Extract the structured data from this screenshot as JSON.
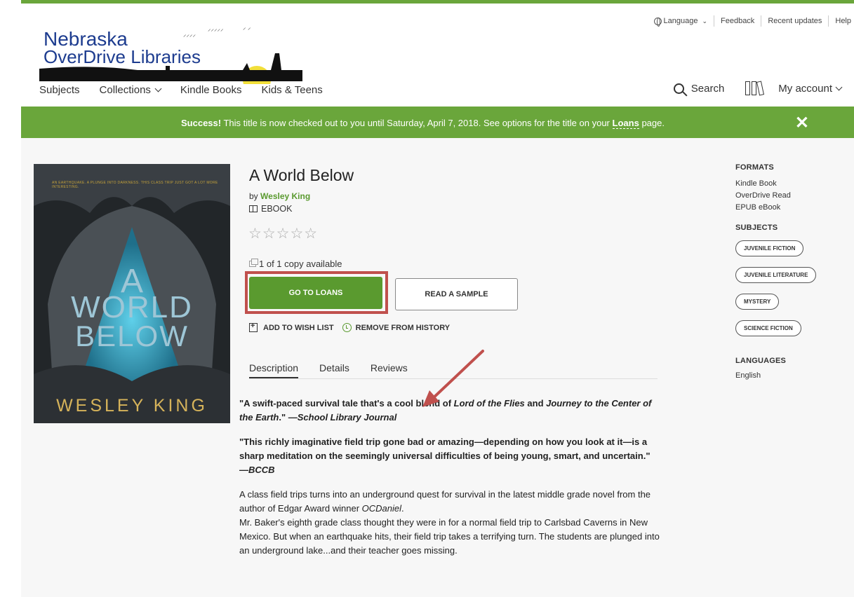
{
  "util_nav": {
    "language": "Language",
    "feedback": "Feedback",
    "recent_updates": "Recent updates",
    "help": "Help"
  },
  "logo": {
    "line1": "Nebraska",
    "line2": "OverDrive Libraries"
  },
  "main_nav": [
    {
      "label": "Subjects"
    },
    {
      "label": "Collections",
      "dropdown": true
    },
    {
      "label": "Kindle Books"
    },
    {
      "label": "Kids & Teens"
    }
  ],
  "right_nav": {
    "search": "Search",
    "account": "My account"
  },
  "banner": {
    "bold": "Success!",
    "text": "This title is now checked out to you until Saturday, April 7, 2018. See options for the title on your",
    "link": "Loans",
    "suffix": "page.",
    "close": "✕"
  },
  "book": {
    "cover_tag": "AN EARTHQUAKE. A PLUNGE INTO DARKNESS. THIS CLASS TRIP JUST GOT A LOT MORE INTERESTING.",
    "cover_line1": "A",
    "cover_line2": "WORLD",
    "cover_line3": "BELOW",
    "cover_author": "WESLEY KING",
    "title": "A World Below",
    "by": "by",
    "author": "Wesley King",
    "format": "EBOOK",
    "stars": "☆☆☆☆☆",
    "copies": "1 of 1 copy available",
    "go_to_loans": "GO TO LOANS",
    "read_sample": "READ A SAMPLE",
    "add_wish": "ADD TO WISH LIST",
    "remove_history": "REMOVE FROM HISTORY"
  },
  "tabs": [
    {
      "label": "Description"
    },
    {
      "label": "Details"
    },
    {
      "label": "Reviews"
    }
  ],
  "description": {
    "q1_a": "\"A swift-paced survival tale that's a cool blend of ",
    "q1_i1": "Lord of the Flies",
    "q1_b": " and ",
    "q1_i2": "Journey to the Center of the Earth",
    "q1_c": ".\" —",
    "q1_src": "School Library Journal",
    "q2": "\"This richly imaginative field trip gone bad or amazing—depending on how you look at it—is a sharp meditation on the seemingly universal difficulties of being young, smart, and uncertain.\" —",
    "q2_src": "BCCB",
    "p3_a": "A class field trips turns into an underground quest for survival in the latest middle grade novel from the author of Edgar Award winner ",
    "p3_i": "OCDaniel",
    "p3_b": ".",
    "p4": "Mr. Baker's eighth grade class thought they were in for a normal field trip to Carlsbad Caverns in New Mexico. But when an earthquake hits, their field trip takes a terrifying turn. The students are plunged into an underground lake...and their teacher goes missing."
  },
  "sidebar": {
    "formats_title": "FORMATS",
    "formats": [
      "Kindle Book",
      "OverDrive Read",
      "EPUB eBook"
    ],
    "subjects_title": "SUBJECTS",
    "subjects": [
      "JUVENILE FICTION",
      "JUVENILE LITERATURE",
      "MYSTERY",
      "SCIENCE FICTION"
    ],
    "languages_title": "LANGUAGES",
    "language": "English"
  },
  "colors": {
    "brand_green": "#6aa63b",
    "button_green": "#5a9a2f",
    "highlight_red": "#c0504d",
    "logo_blue": "#1d3c8f"
  }
}
